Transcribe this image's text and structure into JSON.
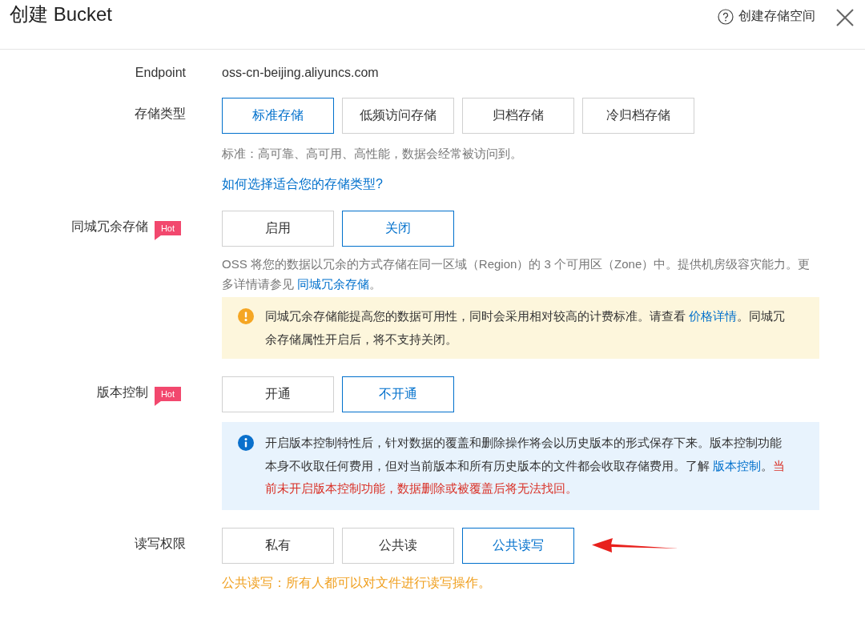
{
  "dialog": {
    "title": "创建 Bucket",
    "help_link": "创建存储空间"
  },
  "fields": [
    {
      "kind": "text",
      "label": "Endpoint",
      "value": "oss-cn-beijing.aliyuncs.com"
    },
    {
      "kind": "options",
      "label": "存储类型",
      "options": [
        {
          "label": "标准存储",
          "selected": true
        },
        {
          "label": "低频访问存储",
          "selected": false
        },
        {
          "label": "归档存储",
          "selected": false
        },
        {
          "label": "冷归档存储",
          "selected": false
        }
      ],
      "description": [
        {
          "kind": "text",
          "text": "标准：高可靠、高可用、高性能，数据会经常被访问到。"
        }
      ],
      "link": "如何选择适合您的存储类型?"
    },
    {
      "kind": "options",
      "label": "同城冗余存储",
      "badge": "Hot",
      "options": [
        {
          "label": "启用",
          "selected": false
        },
        {
          "label": "关闭",
          "selected": true
        }
      ],
      "description": [
        {
          "kind": "text",
          "text": "OSS 将您的数据以冗余的方式存储在同一区域（Region）的 3 个可用区（Zone）中。提供机房级容灾能力。更多详情请参见 "
        },
        {
          "kind": "link",
          "text": "同城冗余存储"
        },
        {
          "kind": "text",
          "text": "。"
        }
      ],
      "notice": {
        "kind": "warning",
        "segments": [
          {
            "kind": "text",
            "text": "同城冗余存储能提高您的数据可用性，同时会采用相对较高的计费标准。请查看 "
          },
          {
            "kind": "link",
            "text": "价格详情"
          },
          {
            "kind": "text",
            "text": "。同城冗余存储属性开启后，将不支持关闭。"
          }
        ]
      }
    },
    {
      "kind": "options",
      "label": "版本控制",
      "badge": "Hot",
      "options": [
        {
          "label": "开通",
          "selected": false
        },
        {
          "label": "不开通",
          "selected": true
        }
      ],
      "notice": {
        "kind": "info",
        "segments": [
          {
            "kind": "text",
            "text": "开启版本控制特性后，针对数据的覆盖和删除操作将会以历史版本的形式保存下来。版本控制功能本身不收取任何费用，但对当前版本和所有历史版本的文件都会收取存储费用。了解 "
          },
          {
            "kind": "link",
            "text": "版本控制"
          },
          {
            "kind": "text",
            "text": "。"
          },
          {
            "kind": "danger",
            "text": "当前未开启版本控制功能，数据删除或被覆盖后将无法找回。"
          }
        ]
      }
    },
    {
      "kind": "options",
      "label": "读写权限",
      "options": [
        {
          "label": "私有",
          "selected": false
        },
        {
          "label": "公共读",
          "selected": false
        },
        {
          "label": "公共读写",
          "selected": true
        }
      ],
      "arrow": true,
      "hint": "公共读写：所有人都可以对文件进行读写操作。"
    }
  ]
}
